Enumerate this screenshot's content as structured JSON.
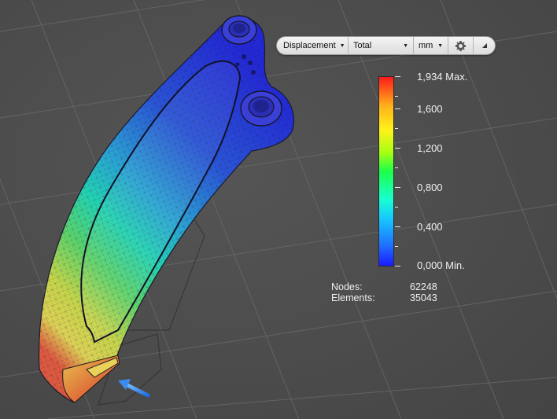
{
  "toolbar": {
    "measure": "Displacement",
    "component": "Total",
    "unit": "mm",
    "settings_icon": "gear-icon",
    "collapse_icon": "collapse-triangle-icon"
  },
  "legend": {
    "max_label": "1,934 Max.",
    "labels": [
      "1,600",
      "1,200",
      "0,800",
      "0,400"
    ],
    "min_label": "0,000 Min.",
    "colors": [
      "#1a1aff",
      "#16c8ff",
      "#1cff4a",
      "#fff21a",
      "#ff1a1a"
    ]
  },
  "stats": {
    "nodes_label": "Nodes:",
    "nodes_value": "62248",
    "elements_label": "Elements:",
    "elements_value": "35043"
  }
}
